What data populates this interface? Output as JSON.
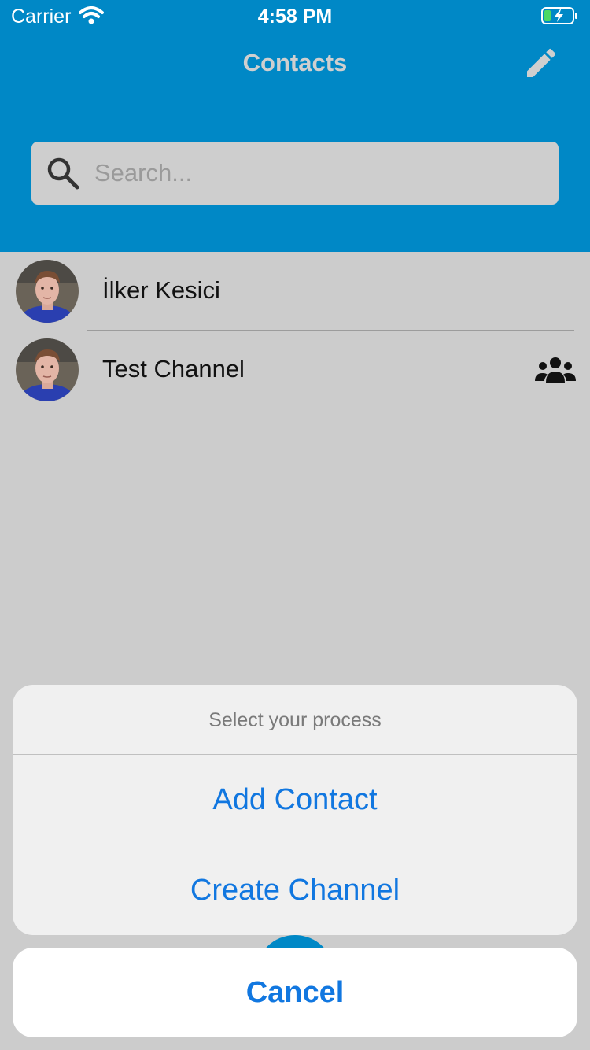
{
  "status_bar": {
    "carrier": "Carrier",
    "time": "4:58 PM"
  },
  "header": {
    "title": "Contacts"
  },
  "search": {
    "placeholder": "Search..."
  },
  "contacts": [
    {
      "name": "İlker Kesici",
      "is_channel": false
    },
    {
      "name": "Test Channel",
      "is_channel": true
    }
  ],
  "action_sheet": {
    "title": "Select your process",
    "actions": [
      "Add Contact",
      "Create Channel"
    ],
    "cancel": "Cancel"
  },
  "colors": {
    "accent": "#0088c6",
    "action": "#1177e0"
  }
}
